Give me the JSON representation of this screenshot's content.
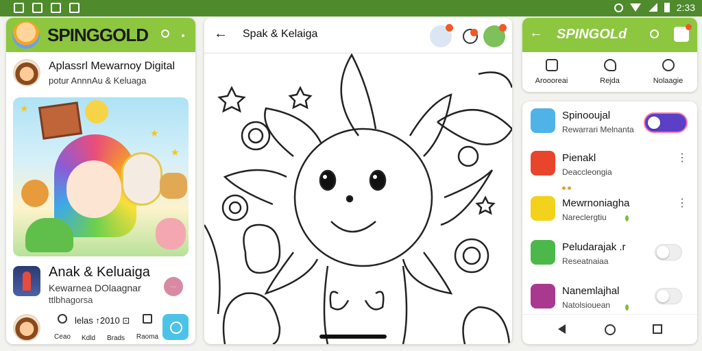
{
  "statusbar": {
    "time": "2:33"
  },
  "panel1": {
    "brand_main": "SPINGGOLD",
    "intro_title": "Aplassrl Mewarnoy Digital",
    "intro_sub": "potur AnnnAu & Keluaga",
    "item_title": "Anak & Keluaiga",
    "item_sub1": "Kewarnea DOlaagnar",
    "item_sub2": "ttlbhagorsa",
    "nav": {
      "mid_text": "lelas ↑2010 ⊡",
      "labels": [
        "Ceao",
        "Kdld",
        "Brads",
        "Raoma"
      ]
    },
    "icons": [
      "search-icon",
      "more-icon",
      "avatar",
      "search-fab-icon"
    ]
  },
  "panel2": {
    "title": "Spak & Kelaiga",
    "colors": {
      "outline": "#222222"
    }
  },
  "panel3": {
    "brand": "SPINGOLd",
    "tabs": [
      {
        "label": "Aroooreai"
      },
      {
        "label": "Rejda"
      },
      {
        "label": "Nolaagie"
      }
    ],
    "rows": [
      {
        "name": "Spinooujal",
        "sub": "Rewarrari Melnanta",
        "control": "toggle-on",
        "color": "#4fb3e8"
      },
      {
        "name": "Pienakl",
        "sub": "Deaccleongia",
        "control": "menu",
        "color": "#e8452c"
      },
      {
        "name": "Mewrnoniagha",
        "sub": "Nareclergtiu",
        "control": "menu",
        "color": "#f3d21b"
      },
      {
        "name": "Peludarajak .r",
        "sub": "Reseatnaiaa",
        "control": "toggle-off",
        "color": "#4cb84a"
      },
      {
        "name": "Nanemlajhal",
        "sub": "Natolsiouean",
        "control": "toggle-off",
        "color": "#a8398f"
      }
    ]
  },
  "theme": {
    "accent": "#8dc63f",
    "status": "#4f8a2c",
    "gold": "#f6c11c",
    "toggle": "#5b3fc7"
  }
}
